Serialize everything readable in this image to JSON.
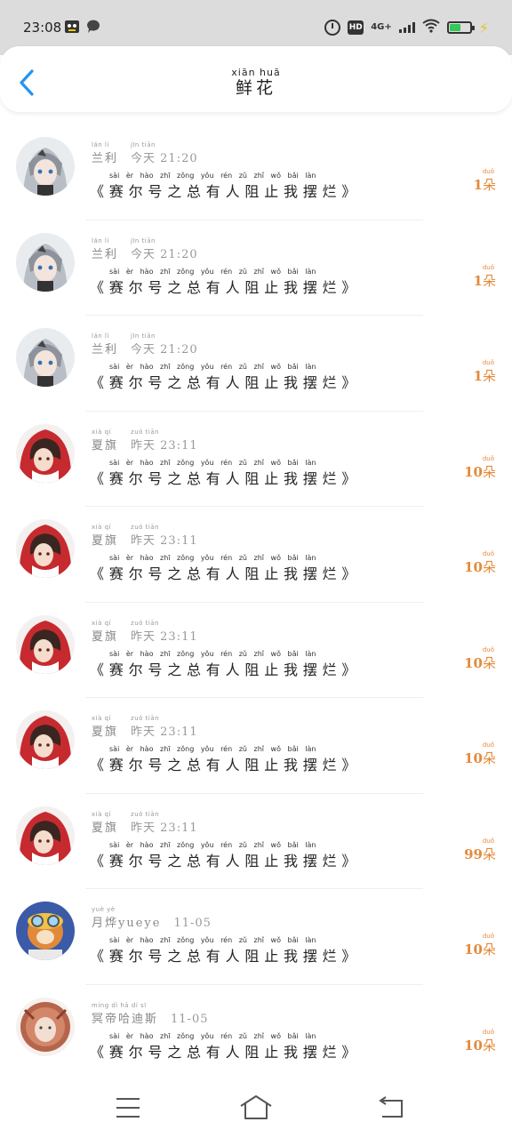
{
  "status_bar": {
    "time": "23:08",
    "network": "4G+",
    "hd": "HD",
    "accent_battery": "#34c759",
    "charging_color": "#e4c22a"
  },
  "header": {
    "title": "鲜花",
    "title_pinyin": "xiān huā",
    "back_icon": "chevron-left-icon",
    "accent": "#2196f3"
  },
  "list": {
    "amount_color": "#e48a3a",
    "items": [
      {
        "name": "兰利",
        "name_py": "lán  lì",
        "time": "今天 21:20",
        "time_py": "jīn tiān",
        "message": "《赛尔号之总有人阻止我摆烂》",
        "message_py": "sài èr hào zhī zǒng yǒu rén zǔ zhǐ wǒ bǎi làn",
        "amount": "1",
        "unit": "朵",
        "unit_py": "duǒ",
        "avatar": "gray-hair-girl"
      },
      {
        "name": "兰利",
        "name_py": "lán  lì",
        "time": "今天 21:20",
        "time_py": "jīn tiān",
        "message": "《赛尔号之总有人阻止我摆烂》",
        "message_py": "sài èr hào zhī zǒng yǒu rén zǔ zhǐ wǒ bǎi làn",
        "amount": "1",
        "unit": "朵",
        "unit_py": "duǒ",
        "avatar": "gray-hair-girl"
      },
      {
        "name": "兰利",
        "name_py": "lán  lì",
        "time": "今天 21:20",
        "time_py": "jīn tiān",
        "message": "《赛尔号之总有人阻止我摆烂》",
        "message_py": "sài èr hào zhī zǒng yǒu rén zǔ zhǐ wǒ bǎi làn",
        "amount": "1",
        "unit": "朵",
        "unit_py": "duǒ",
        "avatar": "gray-hair-girl"
      },
      {
        "name": "夏旗",
        "name_py": "xià  qí",
        "time": "昨天 23:11",
        "time_py": "zuó tiān",
        "message": "《赛尔号之总有人阻止我摆烂》",
        "message_py": "sài èr hào zhī zǒng yǒu rén zǔ zhǐ wǒ bǎi làn",
        "amount": "10",
        "unit": "朵",
        "unit_py": "duǒ",
        "avatar": "red-hood-girl"
      },
      {
        "name": "夏旗",
        "name_py": "xià  qí",
        "time": "昨天 23:11",
        "time_py": "zuó tiān",
        "message": "《赛尔号之总有人阻止我摆烂》",
        "message_py": "sài èr hào zhī zǒng yǒu rén zǔ zhǐ wǒ bǎi làn",
        "amount": "10",
        "unit": "朵",
        "unit_py": "duǒ",
        "avatar": "red-hood-girl"
      },
      {
        "name": "夏旗",
        "name_py": "xià  qí",
        "time": "昨天 23:11",
        "time_py": "zuó tiān",
        "message": "《赛尔号之总有人阻止我摆烂》",
        "message_py": "sài èr hào zhī zǒng yǒu rén zǔ zhǐ wǒ bǎi làn",
        "amount": "10",
        "unit": "朵",
        "unit_py": "duǒ",
        "avatar": "red-hood-girl"
      },
      {
        "name": "夏旗",
        "name_py": "xià  qí",
        "time": "昨天 23:11",
        "time_py": "zuó tiān",
        "message": "《赛尔号之总有人阻止我摆烂》",
        "message_py": "sài èr hào zhī zǒng yǒu rén zǔ zhǐ wǒ bǎi làn",
        "amount": "10",
        "unit": "朵",
        "unit_py": "duǒ",
        "avatar": "red-hood-girl"
      },
      {
        "name": "夏旗",
        "name_py": "xià  qí",
        "time": "昨天 23:11",
        "time_py": "zuó tiān",
        "message": "《赛尔号之总有人阻止我摆烂》",
        "message_py": "sài èr hào zhī zǒng yǒu rén zǔ zhǐ wǒ bǎi làn",
        "amount": "99",
        "unit": "朵",
        "unit_py": "duǒ",
        "avatar": "red-hood-girl"
      },
      {
        "name": "月烨yueye",
        "name_py": "yuè yè",
        "time": "11-05",
        "time_py": "",
        "message": "《赛尔号之总有人阻止我摆烂》",
        "message_py": "sài èr hào zhī zǒng yǒu rén zǔ zhǐ wǒ bǎi làn",
        "amount": "10",
        "unit": "朵",
        "unit_py": "duǒ",
        "avatar": "goggles-character"
      },
      {
        "name": "冥帝哈迪斯",
        "name_py": "míng dì hā dí sī",
        "time": "11-05",
        "time_py": "",
        "message": "《赛尔号之总有人阻止我摆烂》",
        "message_py": "sài èr hào zhī zǒng yǒu rén zǔ zhǐ wǒ bǎi làn",
        "amount": "10",
        "unit": "朵",
        "unit_py": "duǒ",
        "avatar": "lion-mane-character"
      }
    ]
  },
  "nav": {
    "menu_icon": "menu-icon",
    "home_icon": "home-icon",
    "back_icon": "back-icon"
  }
}
